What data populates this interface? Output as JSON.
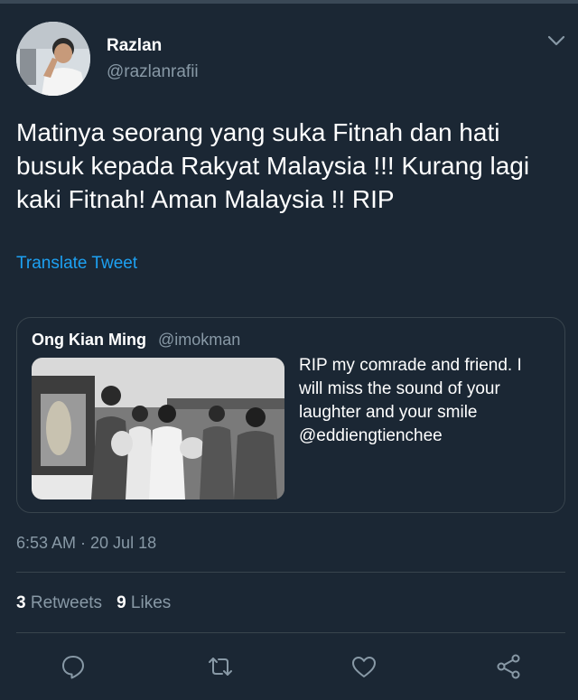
{
  "author": {
    "name": "Razlan",
    "handle": "@razlanrafii",
    "avatar_icon": "person-saluting-avatar"
  },
  "tweet": {
    "lines": [
      "Matinya seorang yang suka Fitnah dan hati",
      "busuk kepada Rakyat Malaysia !!! Kurang lagi",
      "kaki Fitnah! Aman Malaysia !! RIP"
    ],
    "translate_label": "Translate Tweet"
  },
  "quote": {
    "name": "Ong Kian Ming",
    "handle": "@imokman",
    "text_lines": [
      "RIP my comrade and friend. I",
      "will miss the sound of your",
      "laughter and your smile",
      "@eddiengtienchee"
    ],
    "photo_icon": "group-photo-image"
  },
  "meta": {
    "timestamp": "6:53 AM · 20 Jul 18"
  },
  "stats": {
    "retweets_count": "3",
    "retweets_label": "Retweets",
    "likes_count": "9",
    "likes_label": "Likes"
  },
  "actions": [
    {
      "name": "reply-icon"
    },
    {
      "name": "retweet-icon"
    },
    {
      "name": "like-icon"
    },
    {
      "name": "share-icon"
    }
  ],
  "colors": {
    "background": "#1b2734",
    "accent": "#1da1f2",
    "secondary_text": "#8899a6",
    "border": "#38444d"
  }
}
